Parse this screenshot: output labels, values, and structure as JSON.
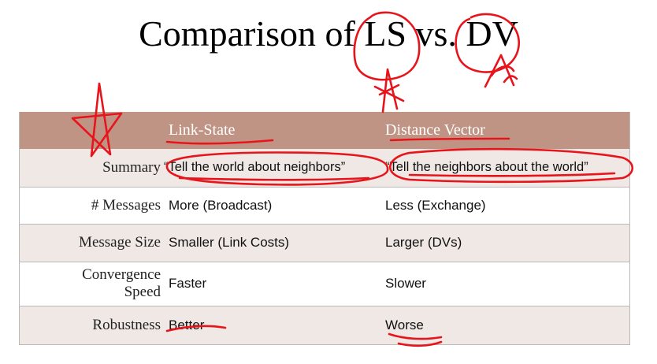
{
  "title": "Comparison of LS vs. DV",
  "table": {
    "headers": [
      "",
      "Link-State",
      "Distance Vector"
    ],
    "rows": [
      {
        "label": "Summary",
        "ls": "“Tell the world about neighbors”",
        "dv": "“Tell the neighbors about the world”"
      },
      {
        "label": "# Messages",
        "ls": "More (Broadcast)",
        "dv": "Less (Exchange)"
      },
      {
        "label": "Message Size",
        "ls": "Smaller (Link Costs)",
        "dv": "Larger (DVs)"
      },
      {
        "label_line1": "Convergence",
        "label_line2": "Speed",
        "ls": "Faster",
        "dv": "Slower"
      },
      {
        "label": "Robustness",
        "ls": "Better",
        "dv": "Worse"
      }
    ]
  },
  "colors": {
    "header_bg": "#c09484",
    "row_shade": "#efe8e4",
    "annotation_ink": "#e8141c"
  }
}
